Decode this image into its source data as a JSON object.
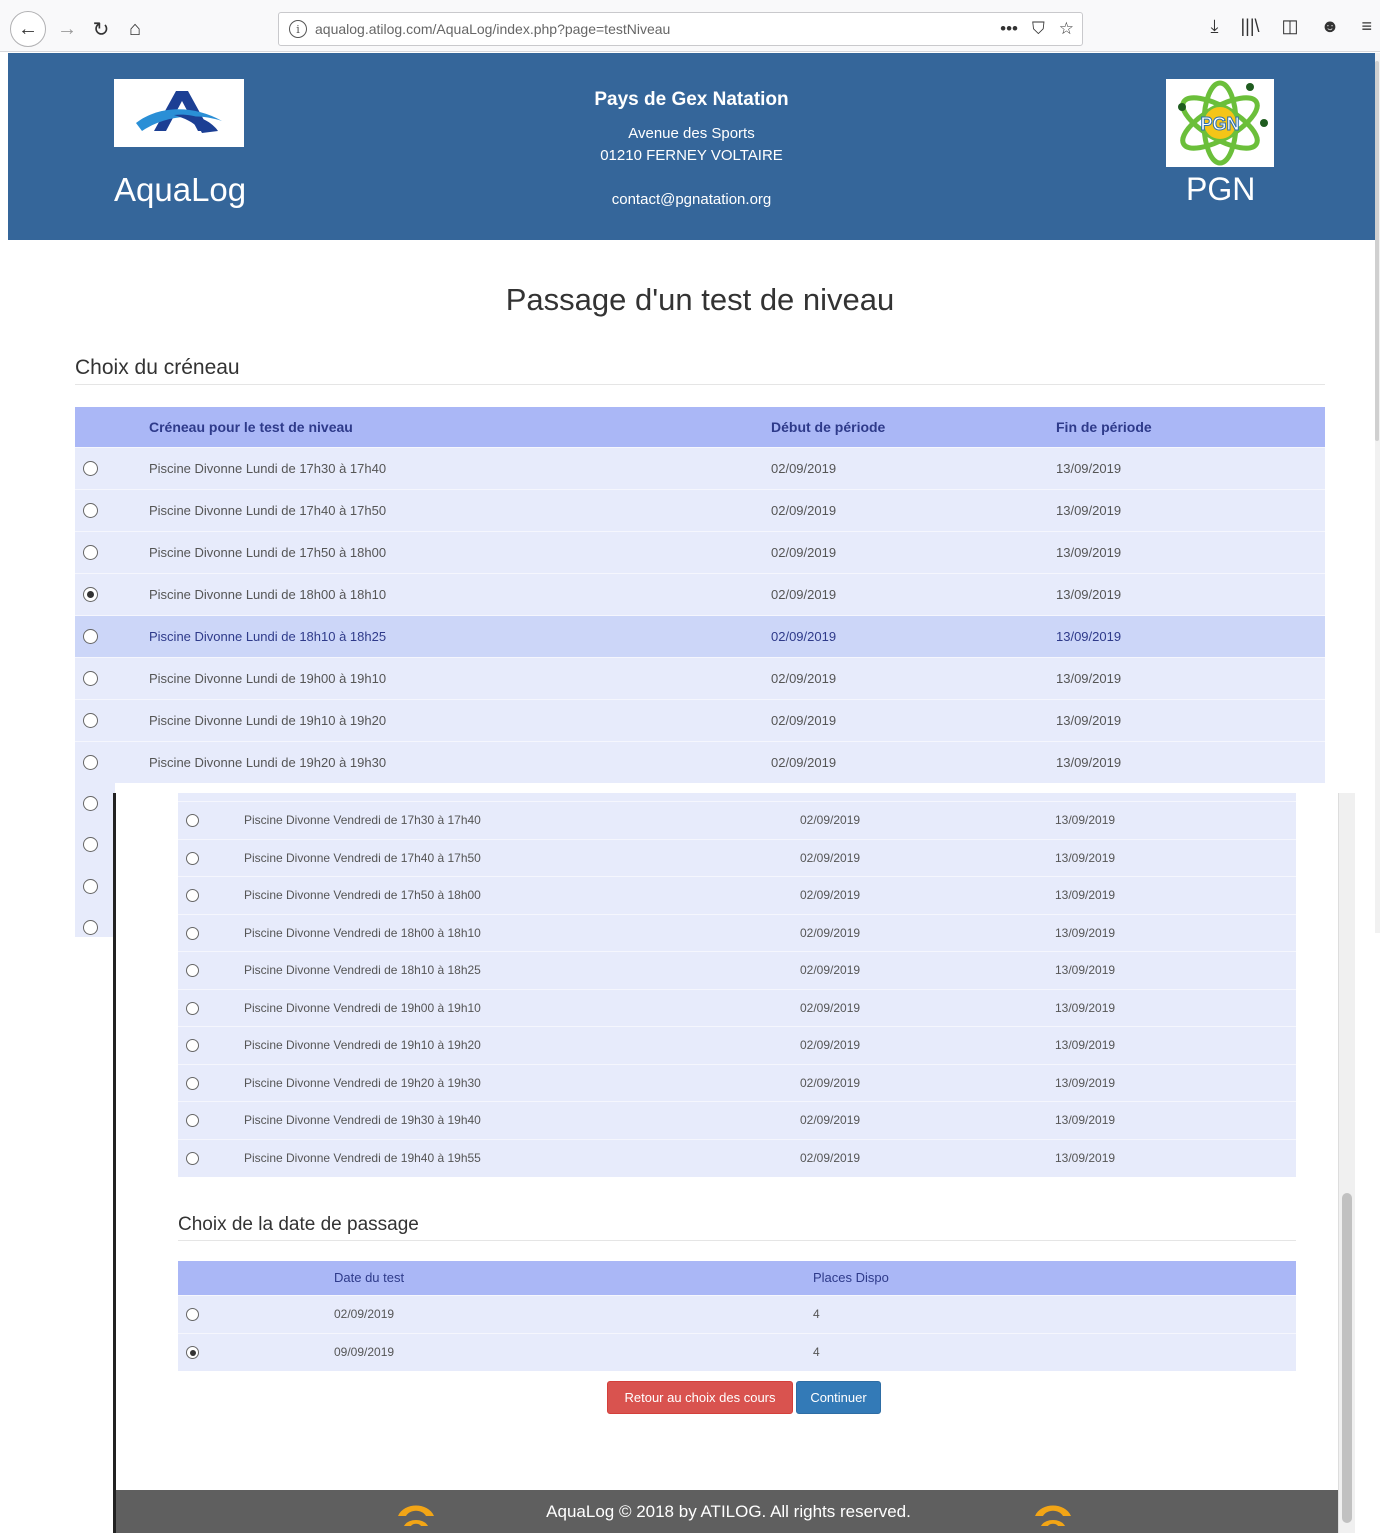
{
  "browser": {
    "url": "aqualog.atilog.com/AquaLog/index.php?page=testNiveau",
    "url_actions": [
      "•••",
      "⛉",
      "☆"
    ],
    "toolbar_icons": [
      "⤓",
      "|||\\",
      "◫",
      "☻",
      "≡"
    ]
  },
  "header": {
    "brand": "AquaLog",
    "club_name": "Pays de Gex Natation",
    "address_line1": "Avenue des Sports",
    "address_line2": "01210 FERNEY VOLTAIRE",
    "email": "contact@pgnatation.org",
    "club_short": "PGN",
    "pgn_logo_text": "PGN"
  },
  "page_title": "Passage d'un test de niveau",
  "section_slot_title": "Choix du créneau",
  "slot_table": {
    "headers": [
      "Créneau pour le test de niveau",
      "Début de période",
      "Fin de période"
    ],
    "rows": [
      {
        "slot": "Piscine Divonne Lundi de 17h30 à 17h40",
        "start": "02/09/2019",
        "end": "13/09/2019",
        "checked": false
      },
      {
        "slot": "Piscine Divonne Lundi de 17h40 à 17h50",
        "start": "02/09/2019",
        "end": "13/09/2019",
        "checked": false
      },
      {
        "slot": "Piscine Divonne Lundi de 17h50 à 18h00",
        "start": "02/09/2019",
        "end": "13/09/2019",
        "checked": false
      },
      {
        "slot": "Piscine Divonne Lundi de 18h00 à 18h10",
        "start": "02/09/2019",
        "end": "13/09/2019",
        "checked": true
      },
      {
        "slot": "Piscine Divonne Lundi de 18h10 à 18h25",
        "start": "02/09/2019",
        "end": "13/09/2019",
        "checked": false,
        "highlight": true
      },
      {
        "slot": "Piscine Divonne Lundi de 19h00 à 19h10",
        "start": "02/09/2019",
        "end": "13/09/2019",
        "checked": false
      },
      {
        "slot": "Piscine Divonne Lundi de 19h10 à 19h20",
        "start": "02/09/2019",
        "end": "13/09/2019",
        "checked": false
      },
      {
        "slot": "Piscine Divonne Lundi de 19h20 à 19h30",
        "start": "02/09/2019",
        "end": "13/09/2019",
        "checked": false
      }
    ]
  },
  "friday_table": {
    "rows": [
      {
        "slot": "Piscine Divonne Vendredi de 17h30 à 17h40",
        "start": "02/09/2019",
        "end": "13/09/2019"
      },
      {
        "slot": "Piscine Divonne Vendredi de 17h40 à 17h50",
        "start": "02/09/2019",
        "end": "13/09/2019"
      },
      {
        "slot": "Piscine Divonne Vendredi de 17h50 à 18h00",
        "start": "02/09/2019",
        "end": "13/09/2019"
      },
      {
        "slot": "Piscine Divonne Vendredi de 18h00 à 18h10",
        "start": "02/09/2019",
        "end": "13/09/2019"
      },
      {
        "slot": "Piscine Divonne Vendredi de 18h10 à 18h25",
        "start": "02/09/2019",
        "end": "13/09/2019"
      },
      {
        "slot": "Piscine Divonne Vendredi de 19h00 à 19h10",
        "start": "02/09/2019",
        "end": "13/09/2019"
      },
      {
        "slot": "Piscine Divonne Vendredi de 19h10 à 19h20",
        "start": "02/09/2019",
        "end": "13/09/2019"
      },
      {
        "slot": "Piscine Divonne Vendredi de 19h20 à 19h30",
        "start": "02/09/2019",
        "end": "13/09/2019"
      },
      {
        "slot": "Piscine Divonne Vendredi de 19h30 à 19h40",
        "start": "02/09/2019",
        "end": "13/09/2019"
      },
      {
        "slot": "Piscine Divonne Vendredi de 19h40 à 19h55",
        "start": "02/09/2019",
        "end": "13/09/2019"
      }
    ]
  },
  "section_date_title": "Choix de la date de passage",
  "date_table": {
    "headers": [
      "Date du test",
      "Places Dispo"
    ],
    "rows": [
      {
        "date": "02/09/2019",
        "places": "4",
        "checked": false
      },
      {
        "date": "09/09/2019",
        "places": "4",
        "checked": true
      }
    ]
  },
  "buttons": {
    "back": "Retour au choix des cours",
    "continue": "Continuer"
  },
  "footer": {
    "text": "AquaLog © 2018 by ATILOG. All rights reserved."
  },
  "colors": {
    "header_bg": "#35669a",
    "table_header_bg": "#aab7f6",
    "row_bg": "#e7ebfb",
    "danger": "#d9534f",
    "primary": "#337ab7",
    "footer_bg": "#5f5f5f"
  }
}
